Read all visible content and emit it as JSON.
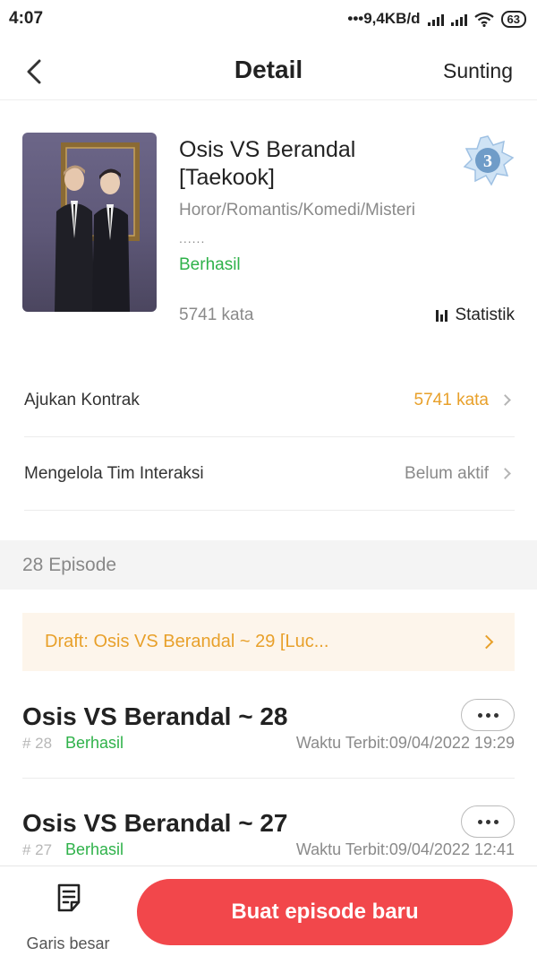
{
  "status_bar": {
    "time": "4:07",
    "network_speed": "•••9,4KB/d",
    "battery": "63"
  },
  "header": {
    "title": "Detail",
    "edit_label": "Sunting"
  },
  "book": {
    "title": "Osis VS Berandal [Taekook]",
    "rank": "3",
    "genres": "Horor/Romantis/Komedi/Misteri",
    "ellipsis": "......",
    "status": "Berhasil",
    "word_count": "5741 kata",
    "stats_label": "Statistik"
  },
  "menu": [
    {
      "label": "Ajukan Kontrak",
      "value": "5741 kata",
      "value_color": "#e8a02a"
    },
    {
      "label": "Mengelola Tim Interaksi",
      "value": "Belum aktif",
      "value_color": "#8a8a8a"
    }
  ],
  "episodes": {
    "header": "28 Episode",
    "draft": "Draft: Osis VS Berandal ~ 29 [Luc...",
    "items": [
      {
        "title": "Osis VS Berandal ~ 28",
        "number": "# 28",
        "status": "Berhasil",
        "published": "Waktu Terbit:09/04/2022 19:29"
      },
      {
        "title": "Osis VS Berandal ~ 27",
        "number": "# 27",
        "status": "Berhasil",
        "published": "Waktu Terbit:09/04/2022 12:41"
      }
    ]
  },
  "bottom_bar": {
    "outline_label": "Garis besar",
    "create_label": "Buat episode baru"
  },
  "colors": {
    "accent_red": "#f2474b",
    "success_green": "#2fb24a",
    "warning_orange": "#e8a02a"
  }
}
